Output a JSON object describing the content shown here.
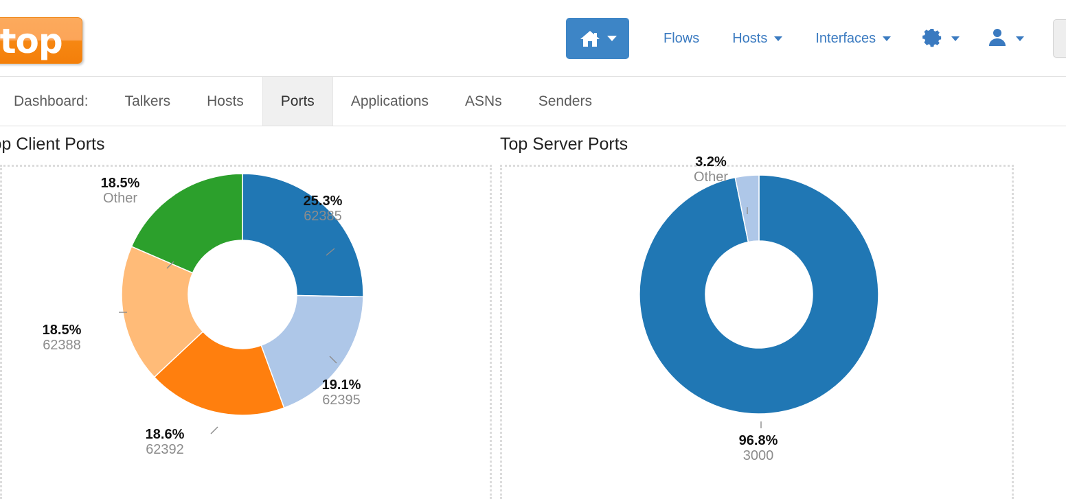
{
  "navbar": {
    "brand_text": "ntop",
    "home_icon": "home-icon",
    "links": [
      {
        "label": "Flows",
        "has_caret": false
      },
      {
        "label": "Hosts",
        "has_caret": true
      },
      {
        "label": "Interfaces",
        "has_caret": true
      }
    ],
    "settings_icon": "gear-icon",
    "user_icon": "user-icon",
    "search_icon": "search-icon"
  },
  "tabs": {
    "prefix_label": "Dashboard:",
    "items": [
      {
        "label": "Talkers",
        "active": false
      },
      {
        "label": "Hosts",
        "active": false
      },
      {
        "label": "Ports",
        "active": true
      },
      {
        "label": "Applications",
        "active": false
      },
      {
        "label": "ASNs",
        "active": false
      },
      {
        "label": "Senders",
        "active": false
      }
    ]
  },
  "panels": {
    "left_title": "Top Client Ports",
    "right_title": "Top Server Ports"
  },
  "colors": {
    "blue": "#2077b4",
    "light_blue": "#aec7e8",
    "orange": "#ff7f0e",
    "light_orange": "#ffbb78",
    "green": "#2ca02c",
    "nav_blue": "#3a7ac0",
    "home_btn": "#3d85c6",
    "brand_orange": "#f47f0a"
  },
  "chart_data": [
    {
      "type": "pie",
      "title": "Top Client Ports",
      "donut": true,
      "hole_ratio": 0.45,
      "start_angle_deg": 0,
      "direction": "clockwise",
      "labels": [
        "62385",
        "62395",
        "62392",
        "62388",
        "Other"
      ],
      "values": [
        25.3,
        19.1,
        18.6,
        18.5,
        18.5
      ],
      "value_unit": "%",
      "colors": [
        "#2077b4",
        "#aec7e8",
        "#ff7f0e",
        "#ffbb78",
        "#2ca02c"
      ],
      "slices": [
        {
          "name": "62385",
          "pct": "25.3%",
          "pct_value": 25.3,
          "color": "#2077b4"
        },
        {
          "name": "62395",
          "pct": "19.1%",
          "pct_value": 19.1,
          "color": "#aec7e8"
        },
        {
          "name": "62392",
          "pct": "18.6%",
          "pct_value": 18.6,
          "color": "#ff7f0e"
        },
        {
          "name": "62388",
          "pct": "18.5%",
          "pct_value": 18.5,
          "color": "#ffbb78"
        },
        {
          "name": "Other",
          "pct": "18.5%",
          "pct_value": 18.5,
          "color": "#2ca02c"
        }
      ]
    },
    {
      "type": "pie",
      "title": "Top Server Ports",
      "donut": true,
      "hole_ratio": 0.45,
      "start_angle_deg": 0,
      "direction": "clockwise",
      "labels": [
        "3000",
        "Other"
      ],
      "values": [
        96.8,
        3.2
      ],
      "value_unit": "%",
      "colors": [
        "#2077b4",
        "#aec7e8"
      ],
      "slices": [
        {
          "name": "3000",
          "pct": "96.8%",
          "pct_value": 96.8,
          "color": "#2077b4"
        },
        {
          "name": "Other",
          "pct": "3.2%",
          "pct_value": 3.2,
          "color": "#aec7e8"
        }
      ]
    }
  ]
}
